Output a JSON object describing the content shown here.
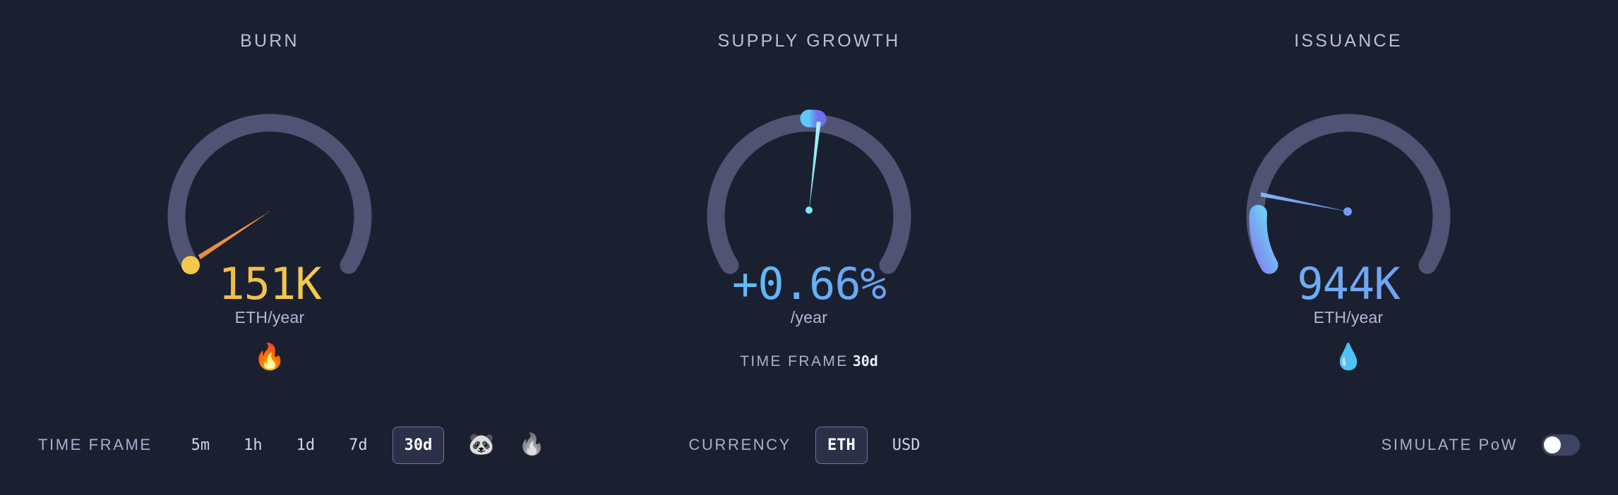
{
  "theme": {
    "background": "#1b2031",
    "track": "#4f5474",
    "text_muted": "#a7afcb",
    "text_bright": "#e9edf8",
    "burn_accent": "#f2994a",
    "burn_dot": "#f2c94c",
    "supply_accent": "#5ee0f0",
    "issuance_accent": "#71bdf5"
  },
  "panels": {
    "burn": {
      "title": "BURN",
      "value": "151K",
      "unit": "ETH/year",
      "glyph": "🔥",
      "glyph_name": "fire-emoji"
    },
    "supply": {
      "title": "SUPPLY GROWTH",
      "value": "+0.66%",
      "unit": "/year",
      "subline_label": "TIME FRAME",
      "subline_value": "30d"
    },
    "issuance": {
      "title": "ISSUANCE",
      "value": "944K",
      "unit": "ETH/year",
      "glyph": "💧",
      "glyph_name": "droplet-emoji"
    }
  },
  "controls": {
    "timeframe": {
      "label": "TIME FRAME",
      "options": [
        "5m",
        "1h",
        "1d",
        "7d",
        "30d"
      ],
      "selected": "30d",
      "extra_icons": [
        {
          "name": "panda-emoji",
          "glyph": "🐼"
        },
        {
          "name": "fire-emoji",
          "glyph": "🔥"
        }
      ]
    },
    "currency": {
      "label": "CURRENCY",
      "options": [
        "ETH",
        "USD"
      ],
      "selected": "ETH"
    },
    "simulate_pow": {
      "label": "SIMULATE PoW",
      "state": "off"
    }
  },
  "chart_data": [
    {
      "type": "gauge",
      "title": "BURN",
      "value": 151000,
      "display_value": "151K",
      "unit": "ETH/year",
      "needle_angle_deg": -48,
      "marker_angle_deg": -126,
      "arc_start_deg": -126,
      "arc_end_deg": 126,
      "track_color": "#4f5474",
      "needle_color": "#f2994a",
      "marker_color": "#f2c94c"
    },
    {
      "type": "gauge",
      "title": "SUPPLY GROWTH",
      "value": 0.66,
      "display_value": "+0.66%",
      "unit": "/year",
      "needle_angle_deg": 4,
      "marker_angle_deg": 2,
      "arc_start_deg": -126,
      "arc_end_deg": 126,
      "track_color": "#4f5474",
      "needle_color": "#7fe8f5",
      "marker_color": "#6ec6f7"
    },
    {
      "type": "gauge",
      "title": "ISSUANCE",
      "value": 944000,
      "display_value": "944K",
      "unit": "ETH/year",
      "needle_angle_deg": -83,
      "arc_segment_start_deg": -126,
      "arc_segment_end_deg": -92,
      "arc_start_deg": -126,
      "arc_end_deg": 126,
      "track_color": "#4f5474",
      "needle_color": "#6f9df2",
      "segment_color_from": "#6fcbf5",
      "segment_color_to": "#8286ee"
    }
  ]
}
